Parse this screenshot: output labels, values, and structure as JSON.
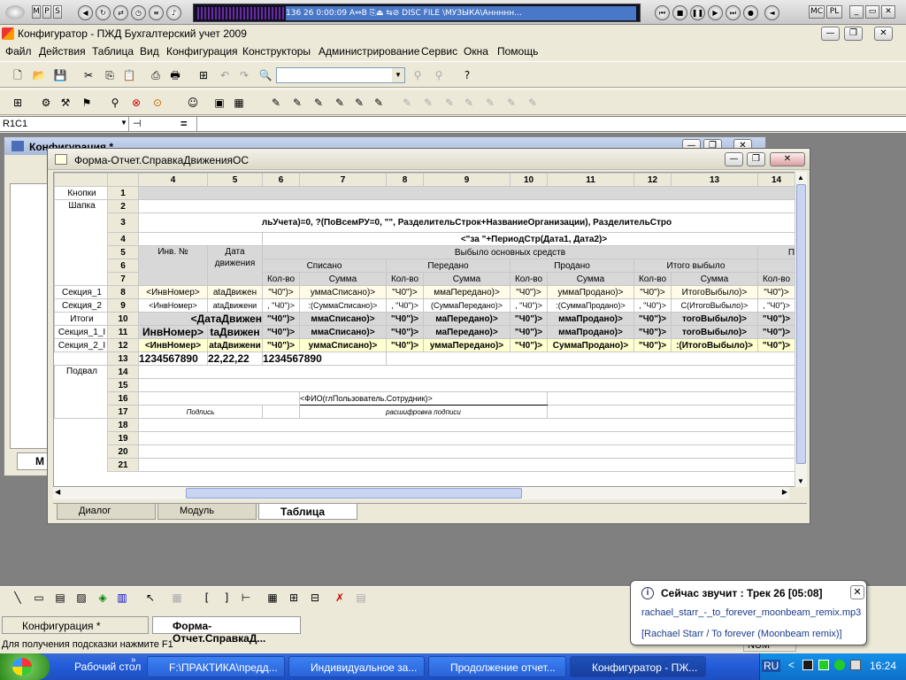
{
  "player": {
    "pos": "136",
    "track_num": "26",
    "elapsed": "0:00:09",
    "info_text": "136   26   0:00:09   A⇔B ⎘⏏ ⇆⊘ DISC FILE   \\МУЗЫКА\\Аннннн...",
    "mini_buttons": [
      "M",
      "P",
      "S"
    ],
    "right_labels": [
      "MC",
      "PL"
    ]
  },
  "app": {
    "title": "Конфигуратор - ПЖД Бухгалтерский учет 2009"
  },
  "menu": [
    "Файл",
    "Действия",
    "Таблица",
    "Вид",
    "Конфигурация",
    "Конструкторы",
    "Администрирование",
    "Сервис",
    "Окна",
    "Помощь"
  ],
  "formula_bar": {
    "cell_ref": "R1C1",
    "equals": "="
  },
  "config_window": {
    "title": "Конфигурация *",
    "tab_label": "М"
  },
  "form_window": {
    "title": "Форма-Отчет.СправкаДвиженияОС",
    "columns": [
      "4",
      "5",
      "6",
      "7",
      "8",
      "9",
      "10",
      "11",
      "12",
      "13",
      "14"
    ],
    "rows": [
      "1",
      "2",
      "3",
      "4",
      "5",
      "6",
      "7",
      "8",
      "9",
      "10",
      "11",
      "12",
      "13",
      "14",
      "15",
      "16",
      "17",
      "18",
      "19",
      "20",
      "21"
    ],
    "sections": {
      "knopki": "Кнопки",
      "shapka": "Шапка",
      "sekc1": "Секция_1",
      "sekc2": "Секция_2",
      "itogi": "Итоги",
      "sekc1i": "Секция_1_I",
      "sekc2i": "Секция_2_I",
      "podval": "Подвал"
    },
    "row3_text": "льУчета)=0, ?(ПоВсемРУ=0, \"\", РазделительСтрок+НазваниеОрганизации), РазделительСтро",
    "row4_text": "<\"за \"+ПериодСтр(Дата1, Дата2)>",
    "hdr_inv": "Инв. №",
    "hdr_date": "Дата движения",
    "hdr_vybylo": "Выбыло основных средств",
    "hdr_p": "П",
    "hdr_spisano": "Списано",
    "hdr_peredano": "Передано",
    "hdr_prodano": "Продано",
    "hdr_itogo": "Итого выбыло",
    "kol": "Кол-во",
    "summa": "Сумма",
    "r8": [
      "<ИнвНомер>",
      "ataДвижен",
      "\"Ч0\")>",
      "уммаСписано)>",
      "\"Ч0\")>",
      "ммаПередано)>",
      "\"Ч0\")>",
      "уммаПродано)>",
      "\"Ч0\")>",
      "ИтогоВыбыло)>",
      "\"Ч0\")>"
    ],
    "r9": [
      "<ИнвНомер>",
      "atаДвижени",
      ", \"Ч0\")>",
      ":(СуммаСписано)>",
      ", \"Ч0\")>",
      "(СуммаПередано)>",
      ", \"Ч0\")>",
      ":(СуммаПродано)>",
      ", \"Ч0\")>",
      "С(ИтогоВыбыло)>",
      ", \"Ч0\")>"
    ],
    "r10": [
      "<ДатаДвижен",
      "\"Ч0\")>",
      "ммаСписано)>",
      "\"Ч0\")>",
      "маПередано)>",
      "\"Ч0\")>",
      "ммаПродано)>",
      "\"Ч0\")>",
      "тогоВыбыло)>",
      "\"Ч0\")>"
    ],
    "r11": [
      "ИнвНомер>",
      "taДвижен",
      "\"Ч0\")>",
      "ммаСписано)>",
      "\"Ч0\")>",
      "маПередано)>",
      "\"Ч0\")>",
      "ммаПродано)>",
      "\"Ч0\")>",
      "тогоВыбыло)>",
      "\"Ч0\")>"
    ],
    "r12": [
      "<ИнвНомер>",
      "ataДвижени",
      "\"Ч0\")>",
      "уммаСписано)>",
      "\"Ч0\")>",
      "уммаПередано)>",
      "\"Ч0\")>",
      "СуммаПродано)>",
      "\"Ч0\")>",
      ":(ИтогоВыбыло)>",
      "\"Ч0\")>"
    ],
    "r13": [
      "1234567890",
      "22,22,22",
      "1234567890"
    ],
    "r16": "<ФИО(глПользователь.Сотрудник)>",
    "r17a": "Подпись",
    "r17b": "расшифровка подписи",
    "tabs": [
      "Диалог",
      "Модуль",
      "Таблица"
    ]
  },
  "window_tabs": [
    "Конфигурация *",
    "Форма-Отчет.СправкаД..."
  ],
  "status_text": "Для получения подсказки нажмите F1",
  "status_right": "NUM",
  "notification": {
    "heading": "Сейчас звучит : Трек 26 [05:08]",
    "file": "rachael_starr_-_to_forever_moonbeam_remix.mp3",
    "tag": "[Rachael Starr / To forever (Moonbeam remix)]"
  },
  "taskbar": {
    "items": [
      "Рабочий стол",
      "F:\\ПРАКТИКА\\предд...",
      "Индивидуальное за...",
      "Продолжение отчет...",
      "Конфигуратор - ПЖ..."
    ],
    "lang": "RU",
    "clock": "16:24"
  },
  "colors": {
    "taskbar": "#245edb",
    "tray": "#0e6fc8",
    "yellow_row": "#ffffcf",
    "section_divider": "#cc0000"
  }
}
